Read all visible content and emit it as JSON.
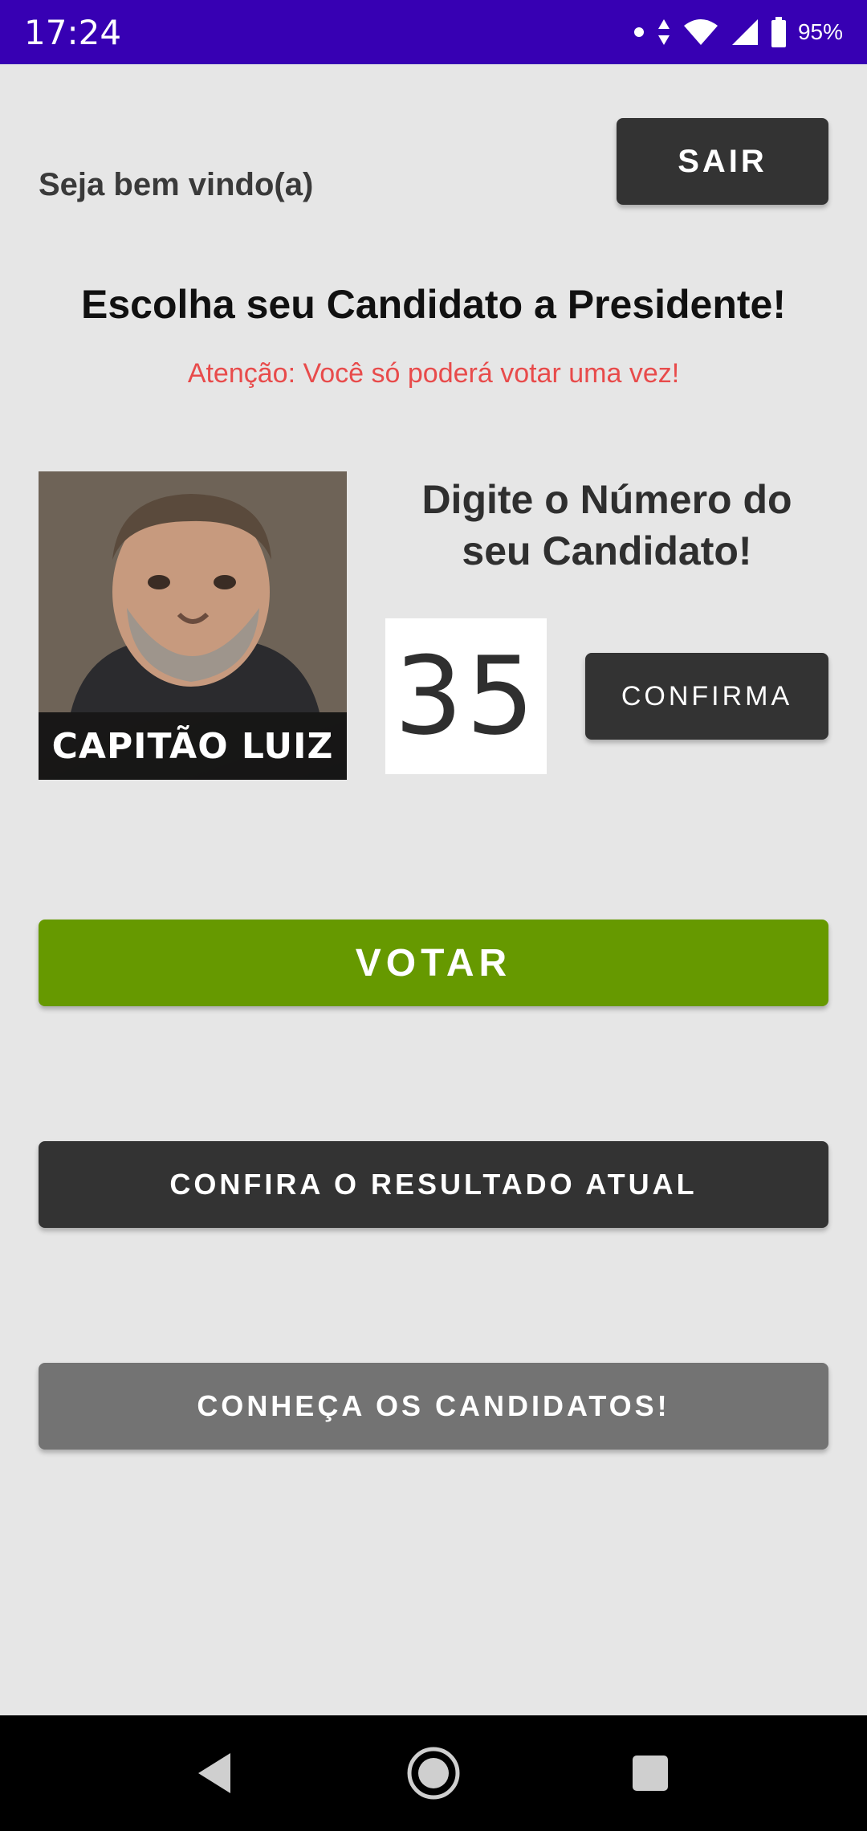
{
  "status_bar": {
    "time": "17:24",
    "battery": "95%",
    "icons": [
      "notification-dot-icon",
      "data-arrows-icon",
      "wifi-icon",
      "signal-icon",
      "battery-icon"
    ]
  },
  "header": {
    "welcome": "Seja bem vindo(a)",
    "logout_label": "SAIR"
  },
  "main": {
    "title": "Escolha seu Candidato a Presidente!",
    "warning": "Atenção: Você só poderá votar uma vez!",
    "candidate_caption": "CAPITÃO LUIZ",
    "prompt_line1": "Digite o Número do",
    "prompt_line2": "seu Candidato!",
    "candidate_number": "35",
    "confirm_label": "CONFIRMA"
  },
  "actions": {
    "vote_label": "VOTAR",
    "results_label": "CONFIRA O RESULTADO ATUAL",
    "candidates_label": "CONHEÇA OS CANDIDATOS!"
  },
  "colors": {
    "status_bar": "#3700b3",
    "background": "#e6e6e6",
    "dark_button": "#333333",
    "vote_button": "#669900",
    "candidates_button": "#737373",
    "warning_text": "#e84b4b"
  },
  "nav_bar": {
    "icons": [
      "back-icon",
      "home-icon",
      "recents-icon"
    ]
  }
}
